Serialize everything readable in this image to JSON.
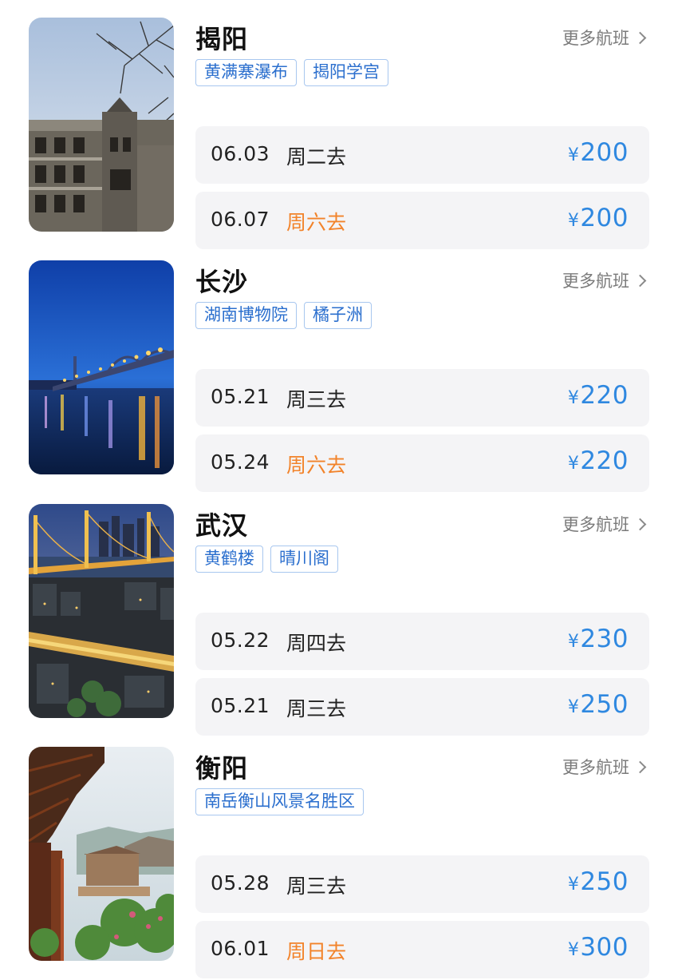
{
  "more_label": "更多航班",
  "colors": {
    "price": "#2f88e0",
    "weekend": "#f2832a",
    "tag_text": "#2b6fce",
    "tag_border": "#a8c7ef"
  },
  "destinations": [
    {
      "city": "揭阳",
      "tags": [
        "黄满寨瀑布",
        "揭阳学宫"
      ],
      "flights": [
        {
          "date": "06.03",
          "day": "周二去",
          "price": "200",
          "weekend": false
        },
        {
          "date": "06.07",
          "day": "周六去",
          "price": "200",
          "weekend": true
        }
      ]
    },
    {
      "city": "长沙",
      "tags": [
        "湖南博物院",
        "橘子洲"
      ],
      "flights": [
        {
          "date": "05.21",
          "day": "周三去",
          "price": "220",
          "weekend": false
        },
        {
          "date": "05.24",
          "day": "周六去",
          "price": "220",
          "weekend": true
        }
      ]
    },
    {
      "city": "武汉",
      "tags": [
        "黄鹤楼",
        "晴川阁"
      ],
      "flights": [
        {
          "date": "05.22",
          "day": "周四去",
          "price": "230",
          "weekend": false
        },
        {
          "date": "05.21",
          "day": "周三去",
          "price": "250",
          "weekend": false
        }
      ]
    },
    {
      "city": "衡阳",
      "tags": [
        "南岳衡山风景名胜区"
      ],
      "flights": [
        {
          "date": "05.28",
          "day": "周三去",
          "price": "250",
          "weekend": false
        },
        {
          "date": "06.01",
          "day": "周日去",
          "price": "300",
          "weekend": true
        }
      ]
    }
  ],
  "currency": "¥"
}
